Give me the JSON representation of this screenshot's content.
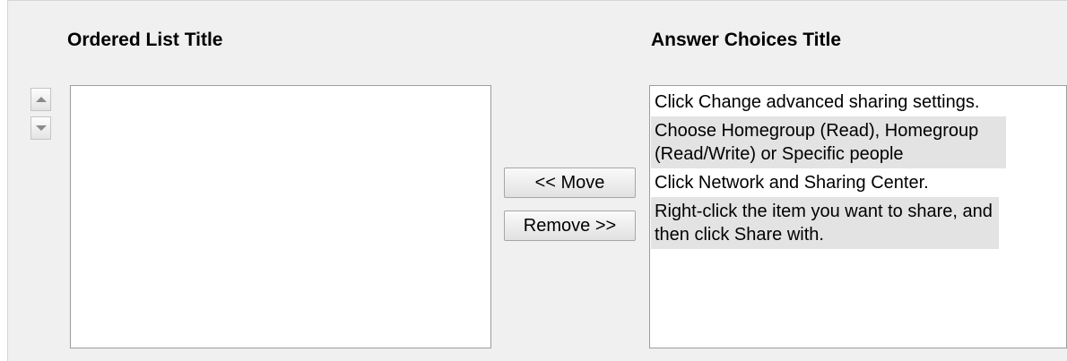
{
  "ordered_list": {
    "title": "Ordered List Title",
    "items": []
  },
  "answer_choices": {
    "title": "Answer Choices Title",
    "items": [
      "Click Change advanced sharing settings.",
      "Choose Homegroup (Read), Homegroup (Read/Write) or Specific people",
      "Click Network and Sharing Center.",
      "Right-click the item you want to share, and then click Share with."
    ]
  },
  "buttons": {
    "move_label": "<< Move",
    "remove_label": "Remove >>"
  },
  "icons": {
    "up": "arrow-up-icon",
    "down": "arrow-down-icon"
  }
}
